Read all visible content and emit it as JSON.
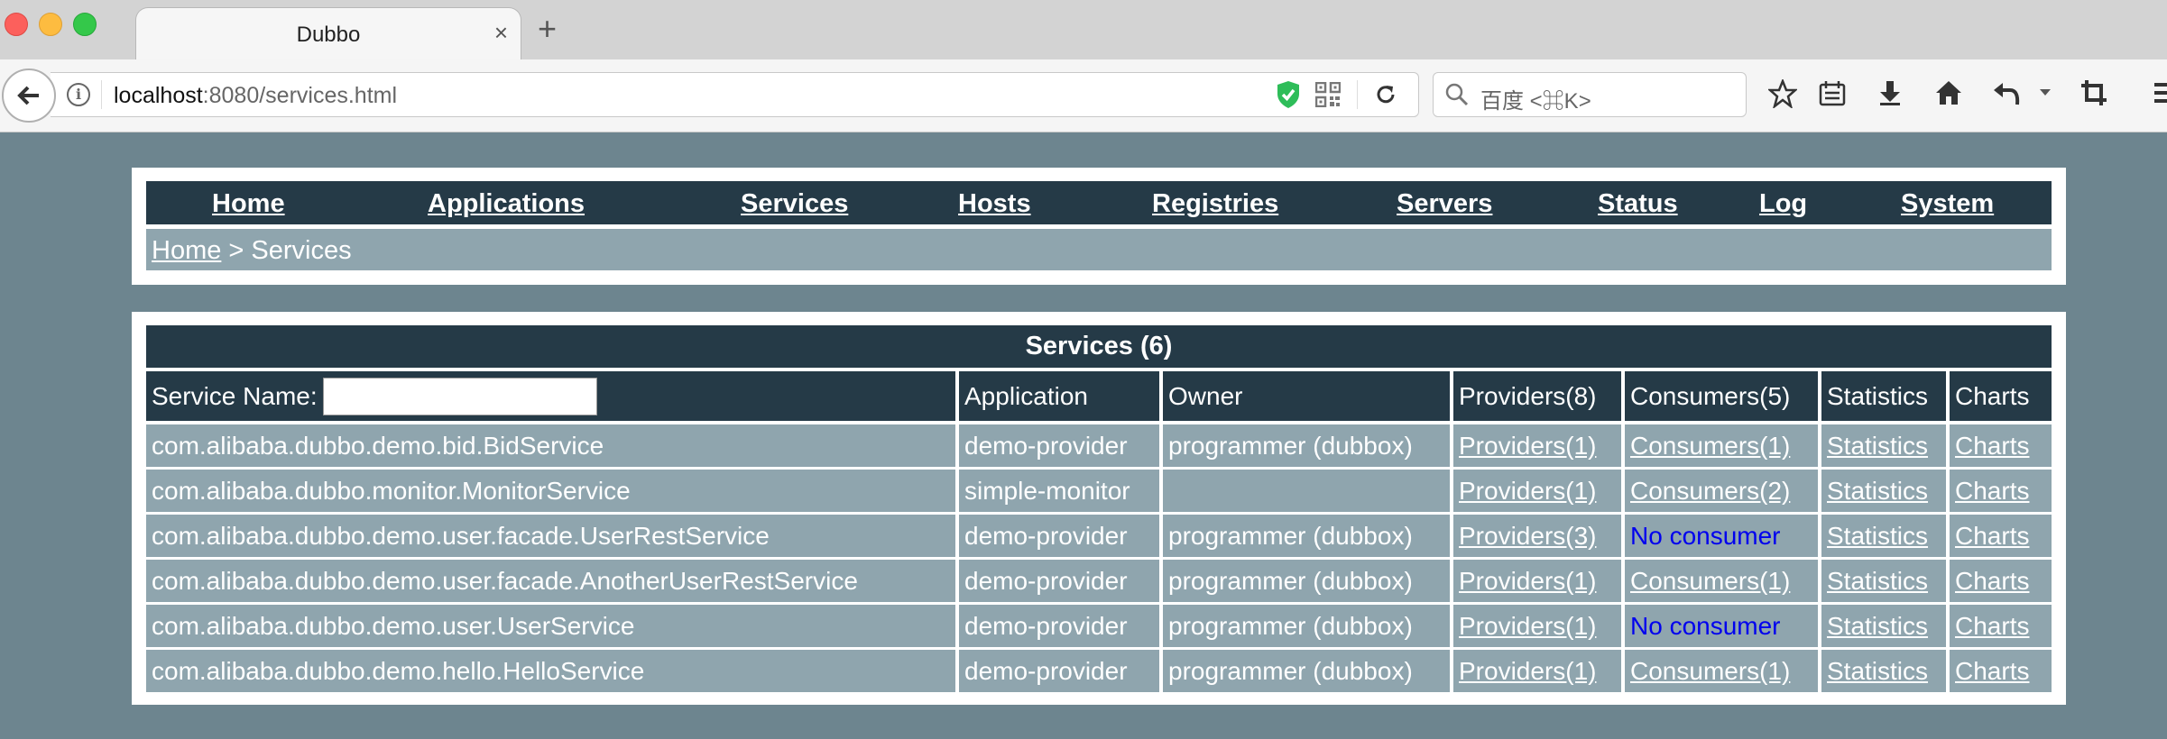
{
  "browser": {
    "tab_title": "Dubbo",
    "tab_close": "×",
    "new_tab": "+",
    "url_host": "localhost",
    "url_path": ":8080/services.html",
    "search_placeholder": "百度 <⌘K>"
  },
  "nav": {
    "items": [
      "Home",
      "Applications",
      "Services",
      "Hosts",
      "Registries",
      "Servers",
      "Status",
      "Log",
      "System"
    ]
  },
  "breadcrumb": {
    "home": "Home",
    "separator": " > ",
    "current": "Services"
  },
  "table": {
    "title": "Services (6)",
    "headers": {
      "service_name_label": "Service Name:",
      "application": "Application",
      "owner": "Owner",
      "providers": "Providers(8)",
      "consumers": "Consumers(5)",
      "statistics": "Statistics",
      "charts": "Charts"
    },
    "search_value": "",
    "rows": [
      {
        "service": "com.alibaba.dubbo.demo.bid.BidService",
        "application": "demo-provider",
        "owner": "programmer (dubbox)",
        "providers": "Providers(1)",
        "consumers": "Consumers(1)",
        "statistics": "Statistics",
        "charts": "Charts"
      },
      {
        "service": "com.alibaba.dubbo.monitor.MonitorService",
        "application": "simple-monitor",
        "owner": "",
        "providers": "Providers(1)",
        "consumers": "Consumers(2)",
        "statistics": "Statistics",
        "charts": "Charts"
      },
      {
        "service": "com.alibaba.dubbo.demo.user.facade.UserRestService",
        "application": "demo-provider",
        "owner": "programmer (dubbox)",
        "providers": "Providers(3)",
        "consumers": "No consumer",
        "statistics": "Statistics",
        "charts": "Charts"
      },
      {
        "service": "com.alibaba.dubbo.demo.user.facade.AnotherUserRestService",
        "application": "demo-provider",
        "owner": "programmer (dubbox)",
        "providers": "Providers(1)",
        "consumers": "Consumers(1)",
        "statistics": "Statistics",
        "charts": "Charts"
      },
      {
        "service": "com.alibaba.dubbo.demo.user.UserService",
        "application": "demo-provider",
        "owner": "programmer (dubbox)",
        "providers": "Providers(1)",
        "consumers": "No consumer",
        "statistics": "Statistics",
        "charts": "Charts"
      },
      {
        "service": "com.alibaba.dubbo.demo.hello.HelloService",
        "application": "demo-provider",
        "owner": "programmer (dubbox)",
        "providers": "Providers(1)",
        "consumers": "Consumers(1)",
        "statistics": "Statistics",
        "charts": "Charts"
      }
    ]
  },
  "colors": {
    "page_bg": "#6d858f",
    "header_bg": "#253a47",
    "row_bg": "#8fa5ae",
    "no_consumer": "#0000ee"
  },
  "icons": [
    "back-icon",
    "info-icon",
    "shield-icon",
    "qr-code-icon",
    "reload-icon",
    "search-icon",
    "bookmark-star-icon",
    "reading-list-icon",
    "download-icon",
    "home-icon",
    "undo-icon",
    "crop-icon",
    "menu-icon"
  ]
}
